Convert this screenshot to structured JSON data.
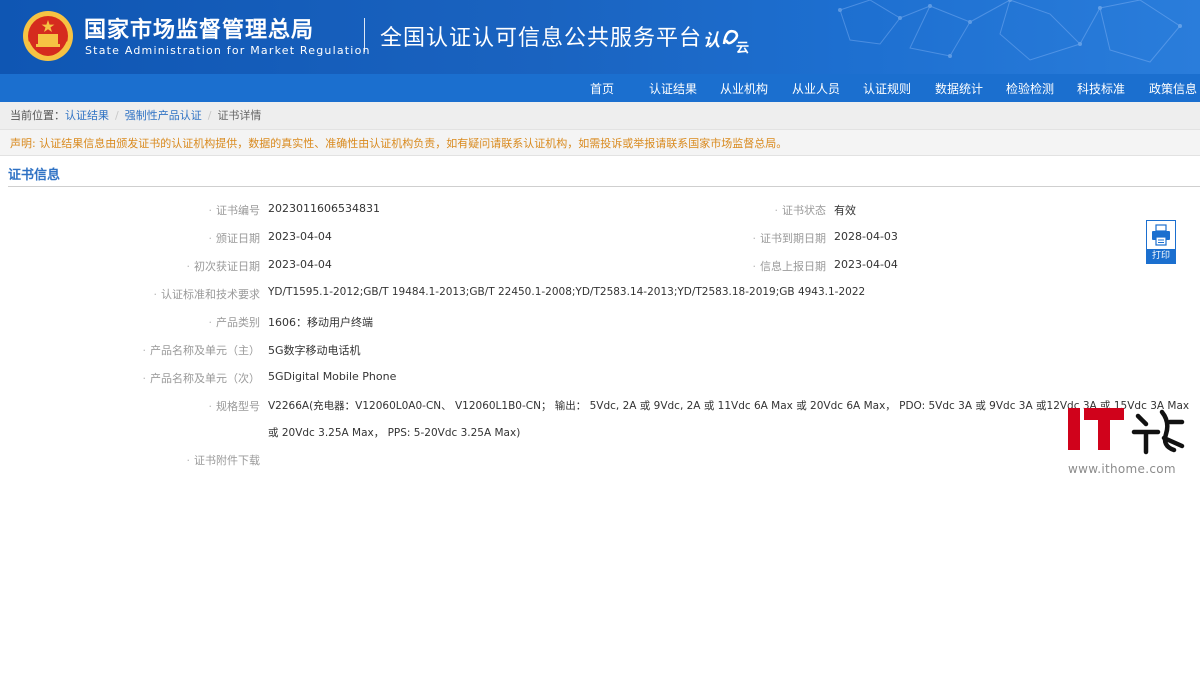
{
  "header": {
    "org_cn": "国家市场监督管理总局",
    "org_en": "State Administration for Market Regulation",
    "platform": "全国认证认可信息公共服务平台",
    "platform_logo": "认e云"
  },
  "nav": [
    "首页",
    "认证结果",
    "从业机构",
    "从业人员",
    "认证规则",
    "数据统计",
    "检验检测",
    "科技标准",
    "政策信息"
  ],
  "breadcrumb": {
    "prefix": "当前位置：",
    "items": [
      "认证结果",
      "强制性产品认证",
      "证书详情"
    ]
  },
  "notice": "声明: 认证结果信息由颁发证书的认证机构提供，数据的真实性、准确性由认证机构负责，如有疑问请联系认证机构，如需投诉或举报请联系国家市场监督总局。",
  "section_title": "证书信息",
  "fields": {
    "cert_no": {
      "label": "证书编号",
      "value": "2023011606534831"
    },
    "status": {
      "label": "证书状态",
      "value": "有效"
    },
    "issue_date": {
      "label": "颁证日期",
      "value": "2023-04-04"
    },
    "expire_date": {
      "label": "证书到期日期",
      "value": "2028-04-03"
    },
    "first_date": {
      "label": "初次获证日期",
      "value": "2023-04-04"
    },
    "report_date": {
      "label": "信息上报日期",
      "value": "2023-04-04"
    },
    "standards": {
      "label": "认证标准和技术要求",
      "value": "YD/T1595.1-2012;GB/T 19484.1-2013;GB/T 22450.1-2008;YD/T2583.14-2013;YD/T2583.18-2019;GB 4943.1-2022"
    },
    "category": {
      "label": "产品类别",
      "value": "1606：移动用户终端"
    },
    "name_main": {
      "label": "产品名称及单元（主）",
      "value": "5G数字移动电话机"
    },
    "name_sub": {
      "label": "产品名称及单元（次）",
      "value": "5GDigital Mobile Phone"
    },
    "model": {
      "label": "规格型号",
      "line1": "V2266A(充电器：V12060L0A0-CN、 V12060L1B0-CN； 输出： 5Vdc, 2A 或 9Vdc, 2A 或 11Vdc 6A Max 或 20Vdc 6A Max， PDO: 5Vdc 3A 或 9Vdc 3A 或12Vdc 3A 或 15Vdc 3A Max",
      "line2": "或 20Vdc 3.25A Max， PPS: 5-20Vdc 3.25A Max)"
    },
    "attachment": {
      "label": "证书附件下载"
    }
  },
  "print_label": "打印",
  "watermark": {
    "logo_text": "IT之家",
    "url": "www.ithome.com"
  },
  "colors": {
    "header_bg": "#1560bd",
    "nav_bg": "#1b6fcf",
    "link": "#2f72c4",
    "notice": "#d98a1e",
    "watermark_red": "#d0021b"
  }
}
